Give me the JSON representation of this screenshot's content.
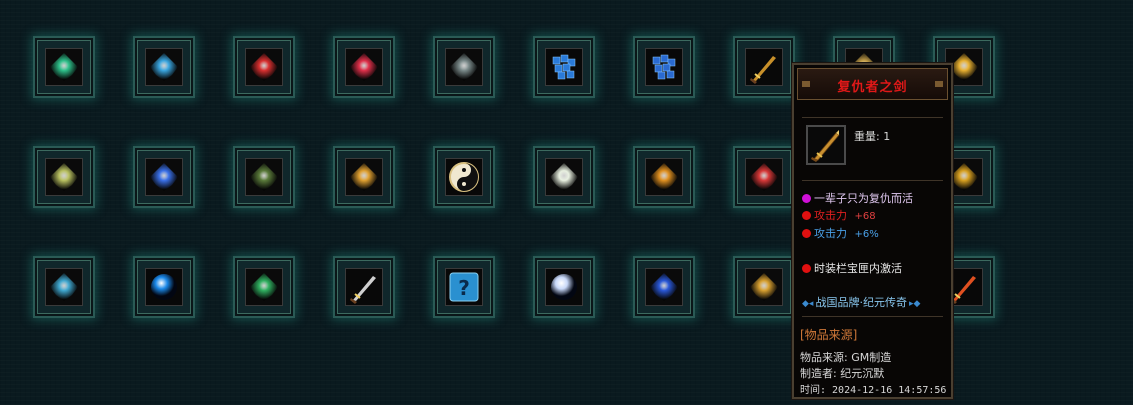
{
  "inventory": {
    "rows": [
      [
        {
          "icon": "green-dragon-wing-icon",
          "color": "#2ec08a"
        },
        {
          "icon": "blue-treasure-chest-icon",
          "color": "#3aa6e0"
        },
        {
          "icon": "red-phoenix-icon",
          "color": "#d93030"
        },
        {
          "icon": "red-flower-gem-icon",
          "color": "#e0304a"
        },
        {
          "icon": "dark-armor-icon",
          "color": "#7a8a8a"
        },
        {
          "icon": "blue-crystal-cluster-icon",
          "color": "#2a7ad8"
        },
        {
          "icon": "blue-crystal-cluster-icon",
          "color": "#2a6ad0"
        },
        {
          "icon": "golden-sword-icon",
          "color": "#c8902a"
        },
        {
          "icon": "golden-relic-icon",
          "color": "#c8a24a"
        },
        {
          "icon": "golden-flame-icon",
          "color": "#e8b030"
        }
      ],
      [
        {
          "icon": "green-gold-emblem-icon",
          "color": "#b8c060"
        },
        {
          "icon": "blue-lightning-claw-icon",
          "color": "#3a70e8"
        },
        {
          "icon": "jade-amulet-icon",
          "color": "#5a7a3a"
        },
        {
          "icon": "golden-heart-icon",
          "color": "#e0a030"
        },
        {
          "icon": "yin-yang-icon",
          "color": "#d8c080"
        },
        {
          "icon": "white-lotus-icon",
          "color": "#e8f0e0"
        },
        {
          "icon": "golden-token-icon",
          "color": "#e09020"
        },
        {
          "icon": "red-blossom-icon",
          "color": "#d83838"
        },
        {
          "icon": "hidden-slot-icon",
          "color": "#1a2a2a"
        },
        {
          "icon": "golden-flowers-icon",
          "color": "#d8a020"
        }
      ],
      [
        {
          "icon": "golden-frame-dragon-icon",
          "color": "#40a8d0"
        },
        {
          "icon": "blue-orb-icon",
          "color": "#1a88e8"
        },
        {
          "icon": "green-serpent-icon",
          "color": "#30b060"
        },
        {
          "icon": "white-scimitar-icon",
          "color": "#d0d0d0"
        },
        {
          "icon": "question-mark-icon",
          "color": "#2a90d0"
        },
        {
          "icon": "glowing-white-orb-icon",
          "color": "#c8d8f8"
        },
        {
          "icon": "blue-fire-bowl-icon",
          "color": "#2a58d8"
        },
        {
          "icon": "golden-rune-disc-icon",
          "color": "#d8a030"
        },
        {
          "icon": "hidden-slot-icon",
          "color": "#1a2a2a"
        },
        {
          "icon": "red-flame-blade-icon",
          "color": "#e05020"
        }
      ]
    ]
  },
  "tooltip": {
    "title": "复仇者之剑",
    "item_icon": "golden-sword-icon",
    "weight": "重量: 1",
    "lines": [
      {
        "text": "一辈子只为复仇而活",
        "value": "",
        "dot_color": "#d010d8",
        "color": "#e0c8f0",
        "value_color": ""
      },
      {
        "text": "攻击力",
        "value": "+68",
        "dot_color": "#e01010",
        "color": "#e02020",
        "value_color": "#e04040"
      },
      {
        "text": "攻击力",
        "value": "+6%",
        "dot_color": "#e01010",
        "color": "#4aa0e8",
        "value_color": "#4aa0e8"
      }
    ],
    "activation": "时装栏宝匣内激活",
    "brand": "战国品牌·纪元传奇",
    "source_header": "[物品来源]",
    "source_lines": [
      "物品来源: GM制造",
      "制造者: 纪元沉默",
      "时间: 2024-12-16 14:57:56"
    ],
    "colors": {
      "title": "#e01818",
      "source_header": "#d07838",
      "brand": "#8ac8f0"
    }
  }
}
